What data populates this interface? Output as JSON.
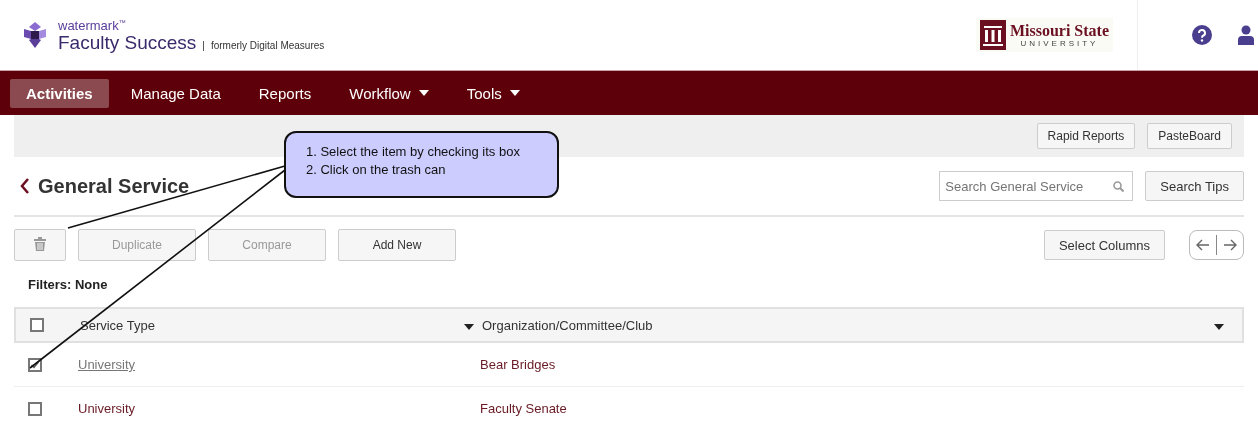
{
  "header": {
    "brand": "watermark$^{™}$",
    "product": "Faculty Success",
    "separator": "|",
    "tagline": "formerly Digital Measures",
    "institution": "Missouri State",
    "institution_sub": "UNIVERSITY"
  },
  "nav": [
    {
      "label": "Activities",
      "selected": true,
      "has_menu": false
    },
    {
      "label": "Manage Data",
      "selected": false,
      "has_menu": false
    },
    {
      "label": "Reports",
      "selected": false,
      "has_menu": false
    },
    {
      "label": "Workflow",
      "selected": false,
      "has_menu": true
    },
    {
      "label": "Tools",
      "selected": false,
      "has_menu": true
    }
  ],
  "utility_buttons": [
    "Rapid Reports",
    "PasteBoard"
  ],
  "page": {
    "title": "General Service",
    "search": {
      "placeholder": "Search General Service"
    },
    "search_tips": "Search Tips"
  },
  "actions": [
    {
      "kind": "trash",
      "disabled": true
    },
    {
      "kind": "text",
      "label": "Duplicate",
      "disabled": true
    },
    {
      "kind": "text",
      "label": "Compare",
      "disabled": true
    },
    {
      "kind": "text",
      "label": "Add New",
      "disabled": false
    }
  ],
  "select_columns": "Select Columns",
  "filters": "Filters: None",
  "table": {
    "all_checked": false,
    "columns": [
      "Service Type",
      "Organization/Committee/Club"
    ],
    "rows": [
      {
        "checked": true,
        "service_type": "University",
        "hovered": true,
        "organization": "Bear Bridges"
      },
      {
        "checked": false,
        "service_type": "University",
        "hovered": false,
        "organization": "Faculty Senate"
      }
    ]
  },
  "callout": {
    "lines": [
      "1. Select the item by checking its box",
      "2. Click on the trash can"
    ]
  }
}
